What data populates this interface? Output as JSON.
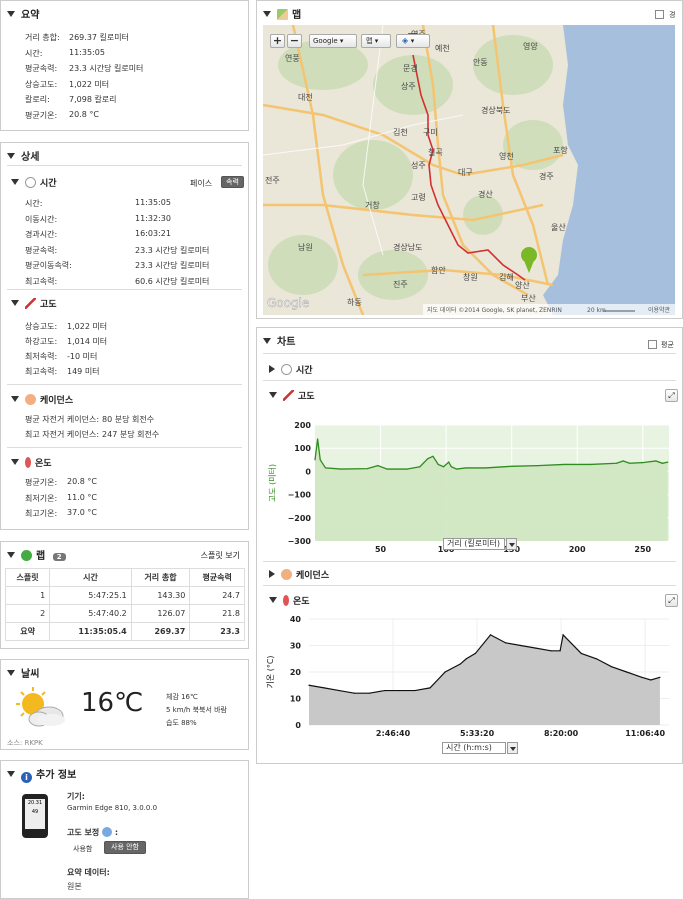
{
  "summary": {
    "title": "요약",
    "rows": [
      {
        "label": "거리 총합:",
        "value": "269.37 킬로미터"
      },
      {
        "label": "시간:",
        "value": "11:35:05"
      },
      {
        "label": "평균속력:",
        "value": "23.3 시간당 킬로미터"
      },
      {
        "label": "상승고도:",
        "value": "1,022 미터"
      },
      {
        "label": "칼로리:",
        "value": "7,098 칼로리"
      },
      {
        "label": "평균기온:",
        "value": "20.8 °C"
      }
    ]
  },
  "details": {
    "title": "상세",
    "time": {
      "title": "시간",
      "toggle_pace": "페이스",
      "toggle_speed": "속력",
      "rows": [
        {
          "label": "시간:",
          "value": "11:35:05"
        },
        {
          "label": "이동시간:",
          "value": "11:32:30"
        },
        {
          "label": "경과시간:",
          "value": "16:03:21"
        },
        {
          "label": "평균속력:",
          "value": "23.3 시간당 킬로미터"
        },
        {
          "label": "평균이동속력:",
          "value": "23.3 시간당 킬로미터"
        },
        {
          "label": "최고속력:",
          "value": "60.6 시간당 킬로미터"
        }
      ]
    },
    "elevation": {
      "title": "고도",
      "rows": [
        {
          "label": "상승고도:",
          "value": "1,022 미터"
        },
        {
          "label": "하강고도:",
          "value": "1,014 미터"
        },
        {
          "label": "최저속력:",
          "value": "-10 미터"
        },
        {
          "label": "최고속력:",
          "value": "149 미터"
        }
      ]
    },
    "cadence": {
      "title": "케이던스",
      "rows": [
        {
          "label": "평균 자전거 케이던스:",
          "value": "80 분당 회전수"
        },
        {
          "label": "최고 자전거 케이던스:",
          "value": "247 분당 회전수"
        }
      ]
    },
    "temperature": {
      "title": "온도",
      "rows": [
        {
          "label": "평균기온:",
          "value": "20.8 °C"
        },
        {
          "label": "최저기온:",
          "value": "11.0 °C"
        },
        {
          "label": "최고기온:",
          "value": "37.0 °C"
        }
      ]
    }
  },
  "laps": {
    "title": "랩",
    "count": "2",
    "view_link": "스플릿 보기",
    "headers": [
      "스플릿",
      "시간",
      "거리 총합",
      "평균속력"
    ],
    "rows": [
      [
        "1",
        "5:47:25.1",
        "143.30",
        "24.7"
      ],
      [
        "2",
        "5:47:40.2",
        "126.07",
        "21.8"
      ]
    ],
    "summary": [
      "요약",
      "11:35:05.4",
      "269.37",
      "23.3"
    ]
  },
  "weather": {
    "title": "날씨",
    "temp": "16℃",
    "feels": "체감 16℃",
    "wind": "5 km/h 북북서 바람",
    "humidity": "습도 88%",
    "source": "소스: RKPK"
  },
  "extra": {
    "title": "추가 정보",
    "device_label": "기기:",
    "device_value": "Garmin Edge 810, 3.0.0.0",
    "elev_corr_label": "고도 보정",
    "elev_on": "사용함",
    "elev_off": "사용 안함",
    "summary_data_label": "요약 데이터:",
    "summary_data_value": "원본",
    "device_screen_top": "20.31",
    "device_screen_mid": "49"
  },
  "map": {
    "title": "맵",
    "fullscreen": "경",
    "zoom_in": "+",
    "zoom_out": "−",
    "provider": "Google",
    "type": "맵",
    "logo": "Google",
    "attribution": "지도 데이터 ©2014 Google, SK planet, ZENRIN",
    "scale": "20 km",
    "terms": "이용약관",
    "labels": {
      "yeongju": "영주",
      "yecheon": "예천",
      "yeongyang": "영양",
      "andong": "안동",
      "yeonpung": "연풍",
      "mungyeong": "문경",
      "daejeon": "대전",
      "sangju": "상주",
      "gyeongbuk": "경상북도",
      "gimcheon": "김천",
      "gumi": "구미",
      "chilgok": "칠곡",
      "yeongcheon": "영천",
      "pohang": "포항",
      "seongju": "성주",
      "daegu": "대구",
      "jeonju": "전주",
      "gyeongju": "경주",
      "goryeong": "고령",
      "geochang": "거창",
      "gyeongsan": "경산",
      "ulsan": "울산",
      "namwon": "남원",
      "gyeongnam": "경상남도",
      "haman": "함안",
      "changwon": "창원",
      "gimhae": "김해",
      "yangsan": "양산",
      "jinju": "진주",
      "busan": "부산",
      "hadong": "하동"
    }
  },
  "charts": {
    "title": "차트",
    "avg_label": "평균",
    "time_title": "시간",
    "elev_title": "고도",
    "cadence_title": "케이던스",
    "temp_title": "온도"
  },
  "chart_data": [
    {
      "type": "area",
      "title": "고도",
      "ylabel": "고도 (미터)",
      "xlabel": "거리 (킬로미터)",
      "xlim": [
        0,
        270
      ],
      "ylim": [
        -300,
        200
      ],
      "xticks": [
        "50",
        "100",
        "150",
        "200",
        "250"
      ],
      "yticks": [
        "200",
        "100",
        "0",
        "−100",
        "−200",
        "−300"
      ],
      "x": [
        0,
        2,
        4,
        8,
        20,
        40,
        48,
        55,
        70,
        80,
        86,
        90,
        94,
        98,
        102,
        104,
        108,
        115,
        130,
        150,
        170,
        190,
        210,
        230,
        235,
        240,
        250,
        260,
        265,
        269
      ],
      "y": [
        50,
        140,
        50,
        15,
        10,
        12,
        25,
        10,
        10,
        20,
        55,
        65,
        30,
        20,
        40,
        20,
        10,
        15,
        15,
        22,
        25,
        30,
        30,
        35,
        45,
        35,
        38,
        45,
        35,
        40
      ]
    },
    {
      "type": "area",
      "title": "온도",
      "ylabel": "기온 (°C)",
      "xlabel": "시간 (h:m:s)",
      "ylim": [
        0,
        40
      ],
      "xticks": [
        "2:46:40",
        "5:33:20",
        "8:20:00",
        "11:06:40"
      ],
      "yticks": [
        "40",
        "30",
        "20",
        "10",
        "0"
      ],
      "x_hours": [
        0,
        0.5,
        1.0,
        1.5,
        2.0,
        2.5,
        3.0,
        3.5,
        4.0,
        4.5,
        5.0,
        5.2,
        5.5,
        6.0,
        6.5,
        7.0,
        7.5,
        8.0,
        8.3,
        8.4,
        9.0,
        9.5,
        10.0,
        10.5,
        11.0,
        11.3,
        11.6
      ],
      "y": [
        15,
        14,
        13,
        12,
        12,
        13,
        13,
        13,
        14,
        20,
        23,
        25,
        27,
        34,
        31,
        30,
        29,
        28,
        28,
        34,
        27,
        25,
        22,
        20,
        18,
        17,
        18
      ]
    }
  ]
}
